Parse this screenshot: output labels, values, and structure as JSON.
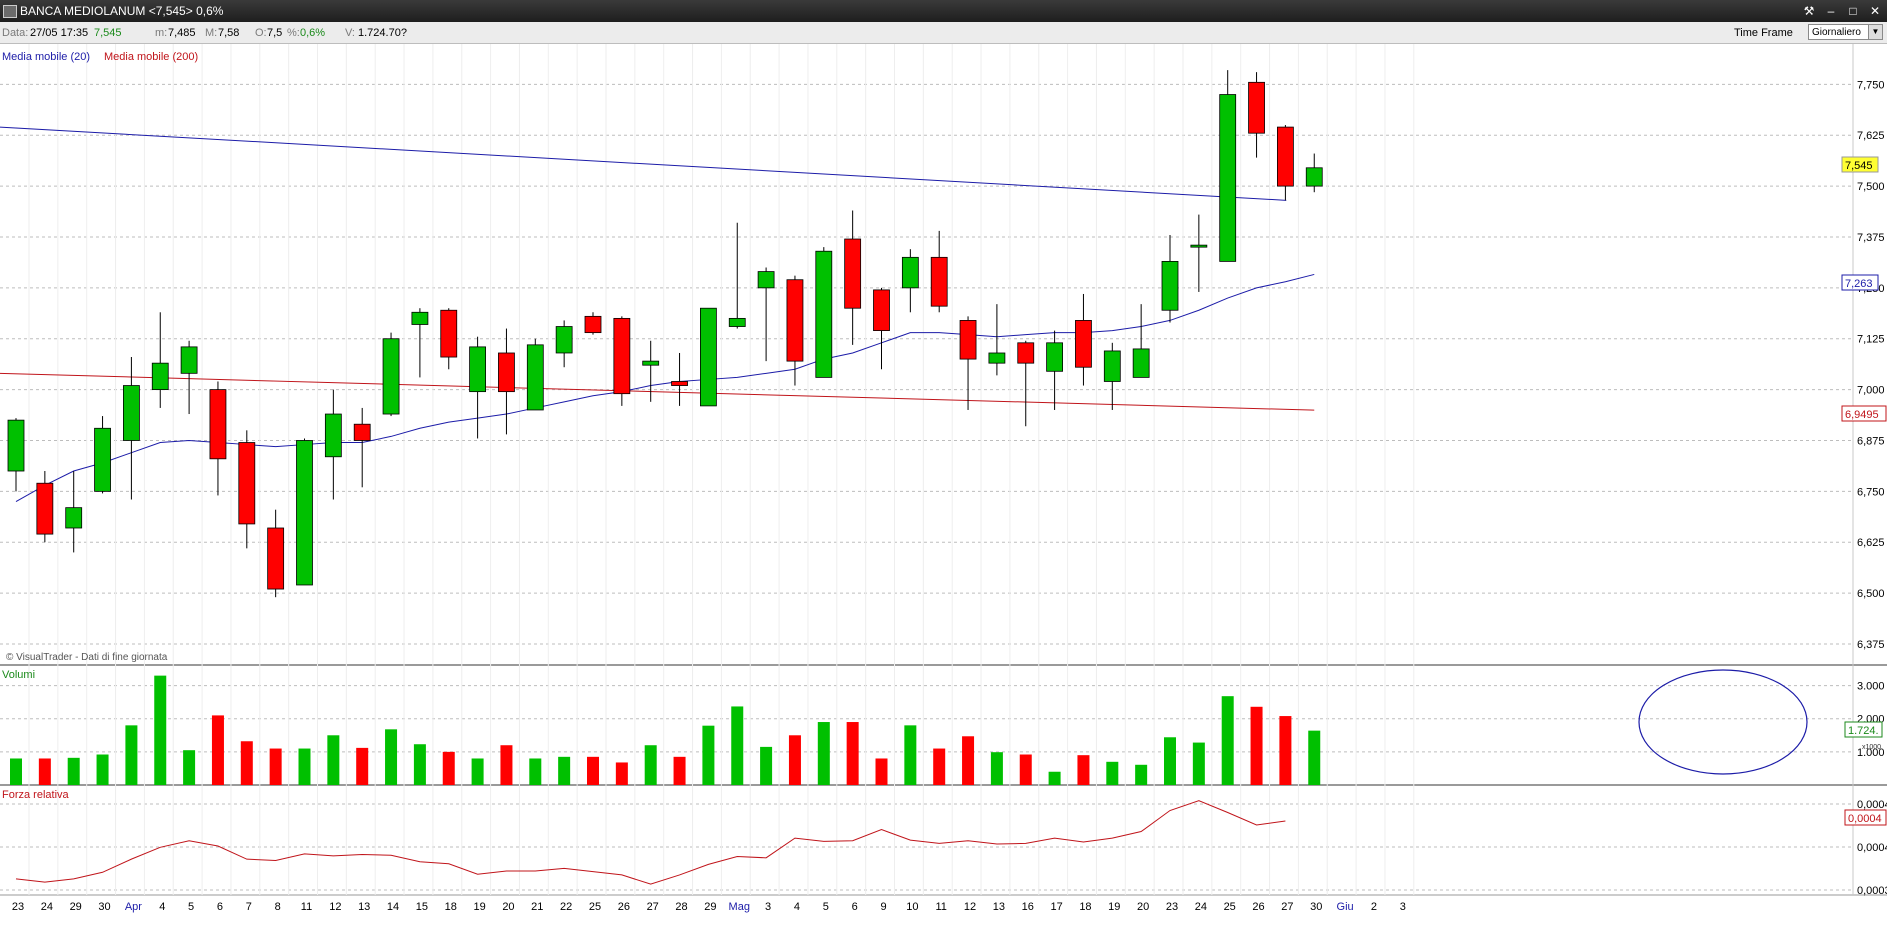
{
  "window": {
    "title": "BANCA MEDIOLANUM <7,545> 0,6%",
    "buttons": [
      "⚒",
      "–",
      "□",
      "✕"
    ]
  },
  "infobar": {
    "data_label": "Data:",
    "data_value": "27/05 17:35",
    "last_value": "7,545",
    "min_label": "m:",
    "min_value": "7,485",
    "max_label": "M:",
    "max_value": "7,58",
    "open_label": "O:",
    "open_value": "7,5",
    "pct_label": "%:",
    "pct_value": "0,6%",
    "vol_label": "V:",
    "vol_value": "1.724.70?",
    "timeframe_label": "Time Frame",
    "timeframe_value": "Giornaliero"
  },
  "chart_data": [
    {
      "type": "candlestick",
      "legend": [
        "Media mobile (20)",
        "Media mobile (200)"
      ],
      "watermark": "© VisualTrader - Dati di fine giornata",
      "ylim": [
        6.375,
        7.8
      ],
      "yticks": [
        "7,750",
        "7,625",
        "7,500",
        "7,375",
        "7,250",
        "7,125",
        "7,000",
        "6,875",
        "6,750",
        "6,625",
        "6,500",
        "6,375"
      ],
      "ytick_values": [
        7.75,
        7.625,
        7.5,
        7.375,
        7.25,
        7.125,
        7.0,
        6.875,
        6.75,
        6.625,
        6.5,
        6.375
      ],
      "last_price_label": "7,545",
      "ma20_label": "7,263",
      "ma200_label": "6,9495",
      "x_labels": [
        "23",
        "24",
        "29",
        "30",
        "Apr",
        "4",
        "5",
        "6",
        "7",
        "8",
        "11",
        "12",
        "13",
        "14",
        "15",
        "18",
        "19",
        "20",
        "21",
        "22",
        "25",
        "26",
        "27",
        "28",
        "29",
        "Mag",
        "3",
        "4",
        "5",
        "6",
        "9",
        "10",
        "11",
        "12",
        "13",
        "16",
        "17",
        "18",
        "19",
        "20",
        "23",
        "24",
        "25",
        "26",
        "27",
        "30",
        "Giu",
        "2",
        "3"
      ],
      "candles": [
        {
          "o": 6.8,
          "h": 6.93,
          "l": 6.75,
          "c": 6.925
        },
        {
          "o": 6.77,
          "h": 6.8,
          "l": 6.625,
          "c": 6.645
        },
        {
          "o": 6.66,
          "h": 6.8,
          "l": 6.6,
          "c": 6.71
        },
        {
          "o": 6.75,
          "h": 6.935,
          "l": 6.745,
          "c": 6.905
        },
        {
          "o": 6.875,
          "h": 7.08,
          "l": 6.73,
          "c": 7.01
        },
        {
          "o": 7.0,
          "h": 7.19,
          "l": 6.955,
          "c": 7.065
        },
        {
          "o": 7.04,
          "h": 7.12,
          "l": 6.94,
          "c": 7.105
        },
        {
          "o": 7.0,
          "h": 7.02,
          "l": 6.74,
          "c": 6.83
        },
        {
          "o": 6.87,
          "h": 6.9,
          "l": 6.61,
          "c": 6.67
        },
        {
          "o": 6.66,
          "h": 6.705,
          "l": 6.49,
          "c": 6.51
        },
        {
          "o": 6.52,
          "h": 6.88,
          "l": 6.52,
          "c": 6.875
        },
        {
          "o": 6.835,
          "h": 7.0,
          "l": 6.73,
          "c": 6.94
        },
        {
          "o": 6.915,
          "h": 6.955,
          "l": 6.76,
          "c": 6.875
        },
        {
          "o": 6.94,
          "h": 7.14,
          "l": 6.935,
          "c": 7.125
        },
        {
          "o": 7.16,
          "h": 7.2,
          "l": 7.03,
          "c": 7.19
        },
        {
          "o": 7.195,
          "h": 7.2,
          "l": 7.05,
          "c": 7.08
        },
        {
          "o": 6.995,
          "h": 7.13,
          "l": 6.88,
          "c": 7.105
        },
        {
          "o": 7.09,
          "h": 7.15,
          "l": 6.89,
          "c": 6.995
        },
        {
          "o": 6.95,
          "h": 7.125,
          "l": 6.95,
          "c": 7.11
        },
        {
          "o": 7.09,
          "h": 7.17,
          "l": 7.055,
          "c": 7.155
        },
        {
          "o": 7.18,
          "h": 7.19,
          "l": 7.135,
          "c": 7.14
        },
        {
          "o": 7.175,
          "h": 7.18,
          "l": 6.96,
          "c": 6.99
        },
        {
          "o": 7.06,
          "h": 7.12,
          "l": 6.97,
          "c": 7.07
        },
        {
          "o": 7.02,
          "h": 7.09,
          "l": 6.96,
          "c": 7.01
        },
        {
          "o": 6.96,
          "h": 7.2,
          "l": 6.96,
          "c": 7.2
        },
        {
          "o": 7.155,
          "h": 7.41,
          "l": 7.15,
          "c": 7.175
        },
        {
          "o": 7.25,
          "h": 7.3,
          "l": 7.07,
          "c": 7.29
        },
        {
          "o": 7.27,
          "h": 7.28,
          "l": 7.01,
          "c": 7.07
        },
        {
          "o": 7.03,
          "h": 7.35,
          "l": 7.03,
          "c": 7.34
        },
        {
          "o": 7.37,
          "h": 7.44,
          "l": 7.11,
          "c": 7.2
        },
        {
          "o": 7.245,
          "h": 7.25,
          "l": 7.05,
          "c": 7.145
        },
        {
          "o": 7.25,
          "h": 7.345,
          "l": 7.19,
          "c": 7.325
        },
        {
          "o": 7.325,
          "h": 7.39,
          "l": 7.19,
          "c": 7.205
        },
        {
          "o": 7.17,
          "h": 7.18,
          "l": 6.95,
          "c": 7.075
        },
        {
          "o": 7.065,
          "h": 7.21,
          "l": 7.035,
          "c": 7.09
        },
        {
          "o": 7.115,
          "h": 7.12,
          "l": 6.91,
          "c": 7.065
        },
        {
          "o": 7.045,
          "h": 7.145,
          "l": 6.95,
          "c": 7.115
        },
        {
          "o": 7.17,
          "h": 7.235,
          "l": 7.01,
          "c": 7.055
        },
        {
          "o": 7.02,
          "h": 7.115,
          "l": 6.95,
          "c": 7.095
        },
        {
          "o": 7.03,
          "h": 7.21,
          "l": 7.03,
          "c": 7.1
        },
        {
          "o": 7.195,
          "h": 7.38,
          "l": 7.165,
          "c": 7.315
        },
        {
          "o": 7.35,
          "h": 7.43,
          "l": 7.24,
          "c": 7.355
        },
        {
          "o": 7.315,
          "h": 7.785,
          "l": 7.315,
          "c": 7.725
        },
        {
          "o": 7.755,
          "h": 7.78,
          "l": 7.57,
          "c": 7.63
        },
        {
          "o": 7.645,
          "h": 7.65,
          "l": 7.465,
          "c": 7.5
        },
        {
          "o": 7.5,
          "h": 7.58,
          "l": 7.485,
          "c": 7.545
        }
      ],
      "ma20": [
        6.725,
        6.765,
        6.8,
        6.82,
        6.845,
        6.87,
        6.875,
        6.87,
        6.865,
        6.86,
        6.865,
        6.87,
        6.87,
        6.885,
        6.905,
        6.92,
        6.93,
        6.94,
        6.955,
        6.97,
        6.985,
        6.995,
        7.01,
        7.02,
        7.025,
        7.03,
        7.04,
        7.05,
        7.075,
        7.09,
        7.115,
        7.14,
        7.14,
        7.135,
        7.13,
        7.135,
        7.14,
        7.14,
        7.145,
        7.155,
        7.17,
        7.195,
        7.225,
        7.25,
        7.265,
        7.283
      ],
      "ma200_start": 7.04,
      "ma200_end": 6.9495,
      "ma20_prev_start": 7.645,
      "ma20_prev_end": 7.465
    },
    {
      "type": "bar",
      "label": "Volumi",
      "yticks": [
        "3.000",
        "2.000",
        "1.000"
      ],
      "ytick_values": [
        3000,
        2000,
        1000
      ],
      "ylim": [
        0,
        3500
      ],
      "last_label": "1.724.",
      "scale_label": "x1000",
      "values": [
        800,
        800,
        820,
        920,
        1800,
        3300,
        1050,
        2100,
        1320,
        1100,
        1100,
        1500,
        1120,
        1680,
        1230,
        1000,
        800,
        1200,
        800,
        850,
        850,
        680,
        1200,
        850,
        1790,
        2370,
        1150,
        1500,
        1900,
        1900,
        800,
        1800,
        1100,
        1470,
        990,
        920,
        400,
        900,
        700,
        610,
        1440,
        1280,
        2680,
        2360,
        2080,
        1640
      ]
    },
    {
      "type": "line",
      "label": "Forza relativa",
      "yticks": [
        "0,0004",
        "0,0004",
        "0,0003"
      ],
      "last_label": "0,0004",
      "values": [
        0.00029,
        0.000285,
        0.00029,
        0.0003,
        0.00032,
        0.000338,
        0.000348,
        0.00034,
        0.00032,
        0.000318,
        0.000328,
        0.000325,
        0.000327,
        0.000326,
        0.000316,
        0.000313,
        0.000297,
        0.000302,
        0.000302,
        0.000306,
        0.000301,
        0.000296,
        0.000282,
        0.000296,
        0.000312,
        0.000324,
        0.000322,
        0.000352,
        0.000347,
        0.000348,
        0.000365,
        0.000349,
        0.000344,
        0.000348,
        0.000343,
        0.000344,
        0.000352,
        0.000346,
        0.000352,
        0.000362,
        0.000394,
        0.000409,
        0.000391,
        0.000372,
        0.000378
      ]
    }
  ]
}
